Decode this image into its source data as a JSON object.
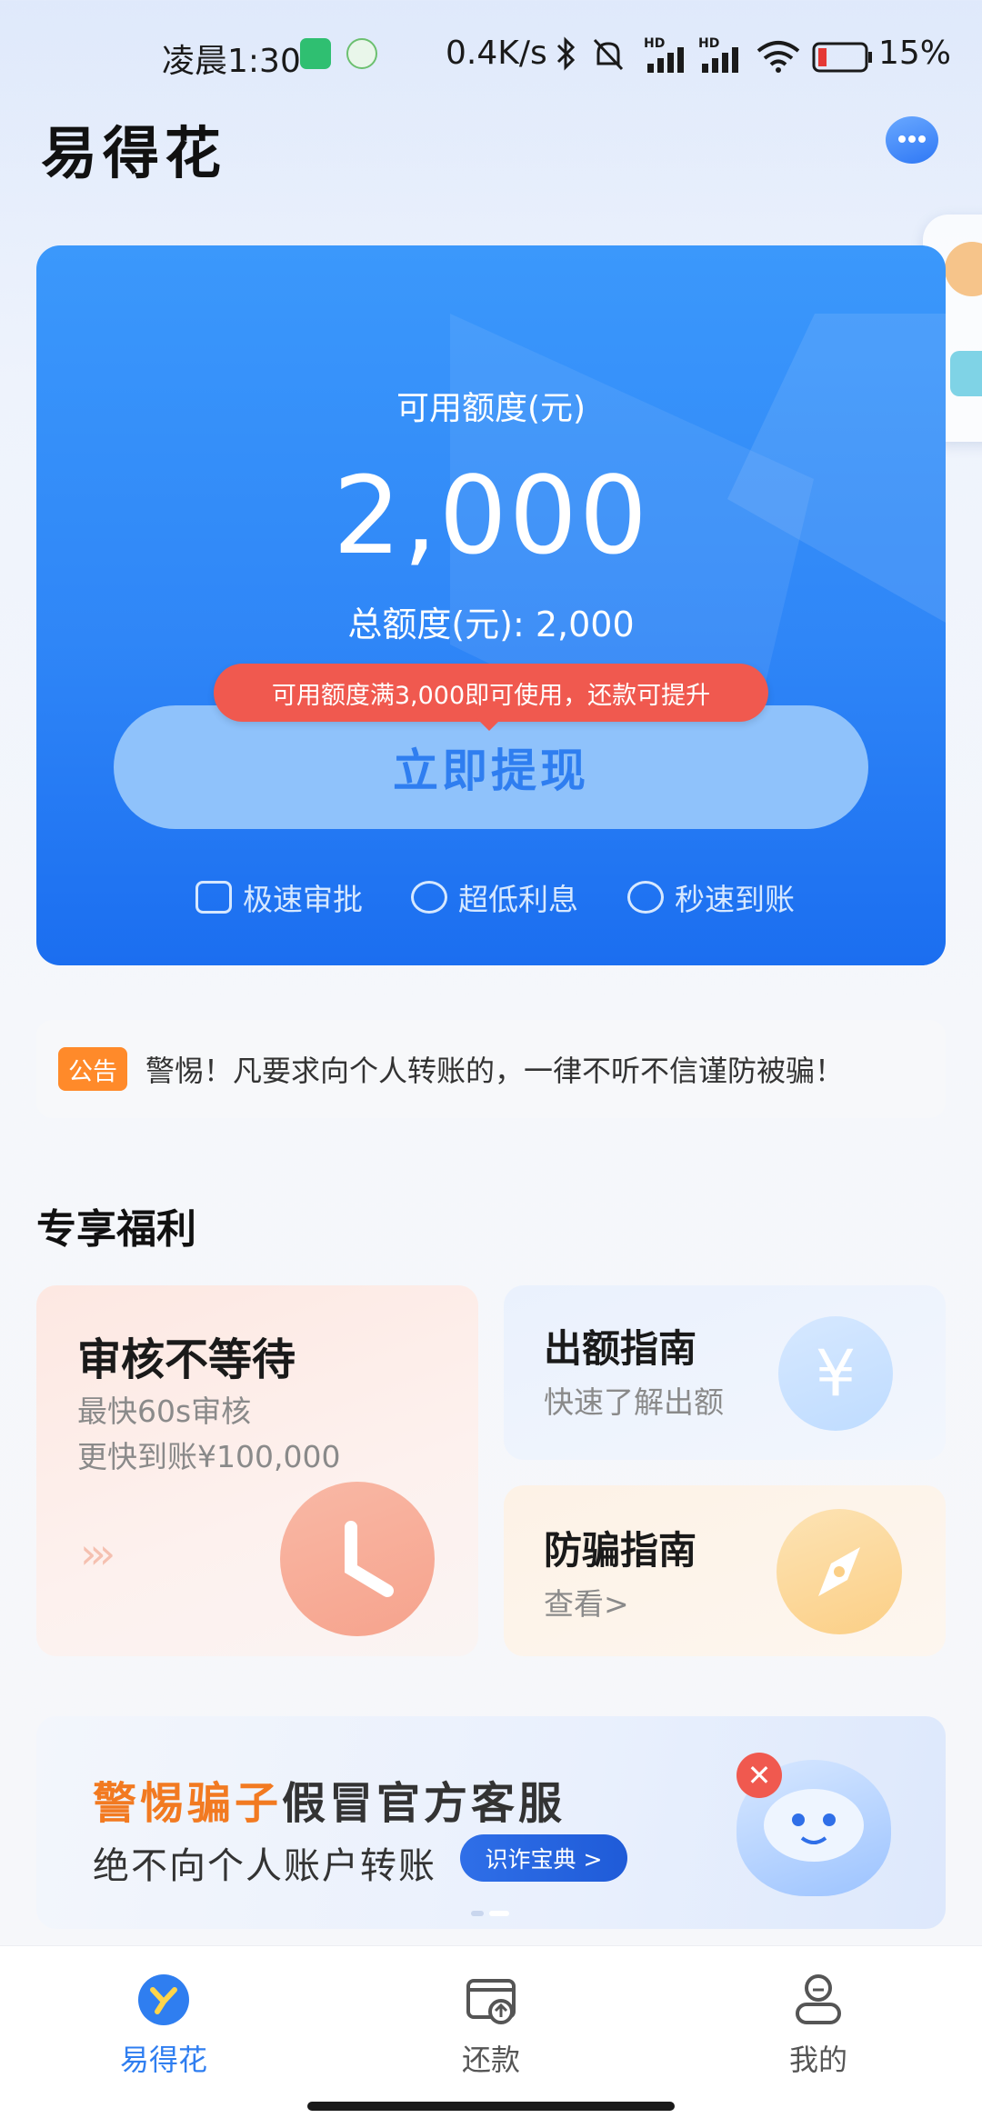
{
  "status_bar": {
    "time": "凌晨1:30",
    "network_speed": "0.4K/s",
    "battery": "15%",
    "hd_label": "HD"
  },
  "header": {
    "app_title": "易得花"
  },
  "credit_card": {
    "available_label": "可用额度(元)",
    "available_amount": "2,000",
    "total_line": "总额度(元): 2,000",
    "tip_text": "可用额度满3,000即可使用，还款可提升",
    "withdraw_label": "立即提现",
    "features": [
      "极速审批",
      "超低利息",
      "秒速到账"
    ]
  },
  "notice": {
    "badge": "公告",
    "text": "警惕！凡要求向个人转账的，一律不听不信谨防被骗！"
  },
  "benefits": {
    "title": "专享福利",
    "review_card": {
      "title": "审核不等待",
      "line1": "最快60s审核",
      "line2": "更快到账¥100,000"
    },
    "amount_card": {
      "title": "出额指南",
      "subtitle": "快速了解出额",
      "icon_glyph": "¥"
    },
    "fraud_card": {
      "title": "防骗指南",
      "subtitle": "查看>"
    }
  },
  "banner": {
    "head_orange": "警惕骗子",
    "head_dark": "假冒官方客服",
    "sub": "绝不向个人账户转账",
    "button": "识诈宝典 >"
  },
  "bottom_nav": {
    "items": [
      {
        "label": "易得花",
        "active": true
      },
      {
        "label": "还款",
        "active": false
      },
      {
        "label": "我的",
        "active": false
      }
    ]
  },
  "colors": {
    "brand_blue": "#2f86f7",
    "tip_red": "#f0594f",
    "notice_orange": "#ff8a2a",
    "banner_orange": "#f27a21",
    "nav_active": "#2f7ef0",
    "nav_inactive": "#555555"
  }
}
